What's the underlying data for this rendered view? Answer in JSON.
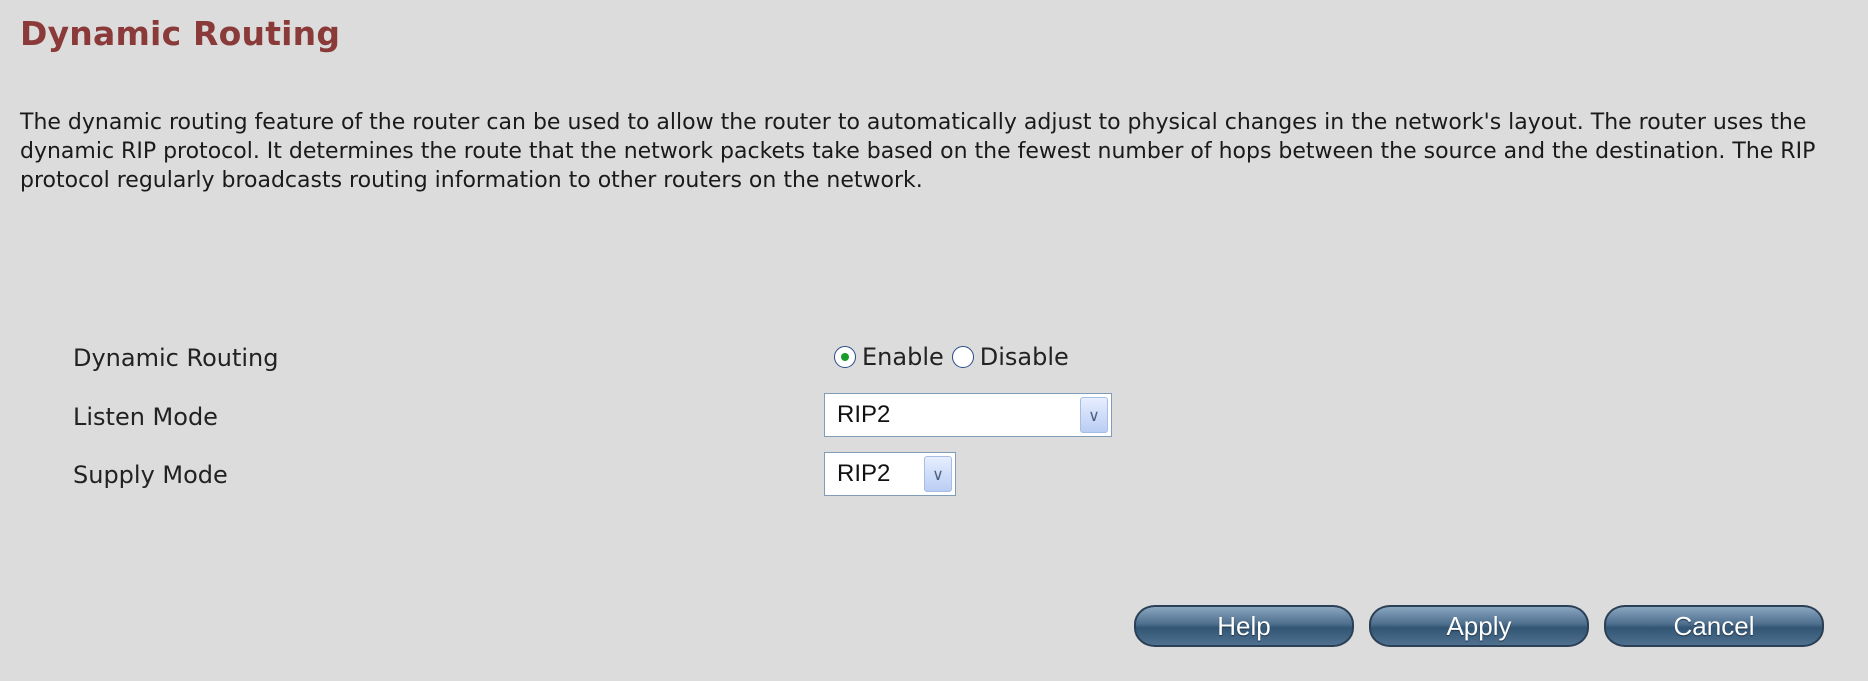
{
  "page": {
    "title": "Dynamic Routing",
    "description": "The dynamic routing feature of the router can be used to allow the router to automatically adjust to physical changes in the network's layout. The router uses the dynamic RIP protocol. It determines the route that the network packets take based on the fewest number of hops between the source and the destination. The RIP protocol regularly broadcasts routing information to other routers on the network."
  },
  "form": {
    "dynamic_routing": {
      "label": "Dynamic Routing",
      "enable_label": "Enable",
      "disable_label": "Disable",
      "selected": "Enable"
    },
    "listen_mode": {
      "label": "Listen Mode",
      "value": "RIP2"
    },
    "supply_mode": {
      "label": "Supply Mode",
      "value": "RIP2"
    }
  },
  "buttons": {
    "help": "Help",
    "apply": "Apply",
    "cancel": "Cancel"
  },
  "icons": {
    "select_arrow": "chevron-down-icon"
  },
  "colors": {
    "title": "#8b3a3a",
    "background": "#dcdcdc",
    "radio_selected_dot": "#1a9c2a",
    "button": "#4d6e8d"
  }
}
